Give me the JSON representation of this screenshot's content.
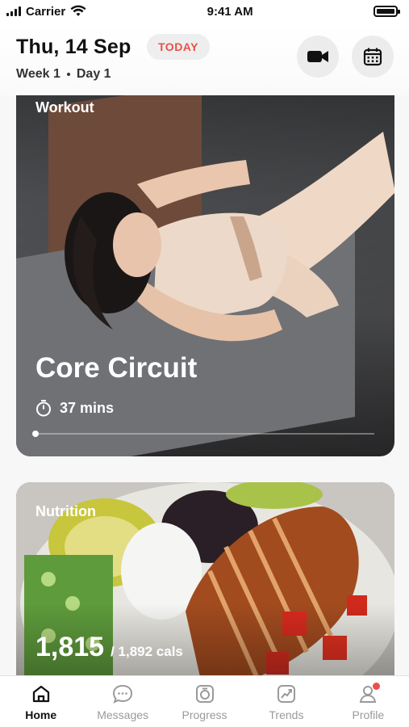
{
  "status_bar": {
    "carrier": "Carrier",
    "time": "9:41 AM"
  },
  "header": {
    "date": "Thu, 14 Sep",
    "today_label": "TODAY",
    "week": "Week 1",
    "day": "Day 1",
    "video_icon": "video-camera-icon",
    "calendar_icon": "calendar-icon"
  },
  "workout": {
    "label": "Workout",
    "title": "Core Circuit",
    "duration": "37 mins",
    "progress": 0.0
  },
  "nutrition": {
    "label": "Nutrition",
    "calories": "1,815",
    "goal": "/ 1,892 cals"
  },
  "tabs": [
    {
      "label": "Home",
      "icon": "home-icon",
      "active": true
    },
    {
      "label": "Messages",
      "icon": "messages-icon",
      "active": false
    },
    {
      "label": "Progress",
      "icon": "progress-icon",
      "active": false
    },
    {
      "label": "Trends",
      "icon": "trends-icon",
      "active": false
    },
    {
      "label": "Profile",
      "icon": "profile-icon",
      "active": false
    }
  ],
  "colors": {
    "accent": "#e8504a",
    "active_tab": "#111111",
    "inactive_tab": "#9a9a9a"
  }
}
